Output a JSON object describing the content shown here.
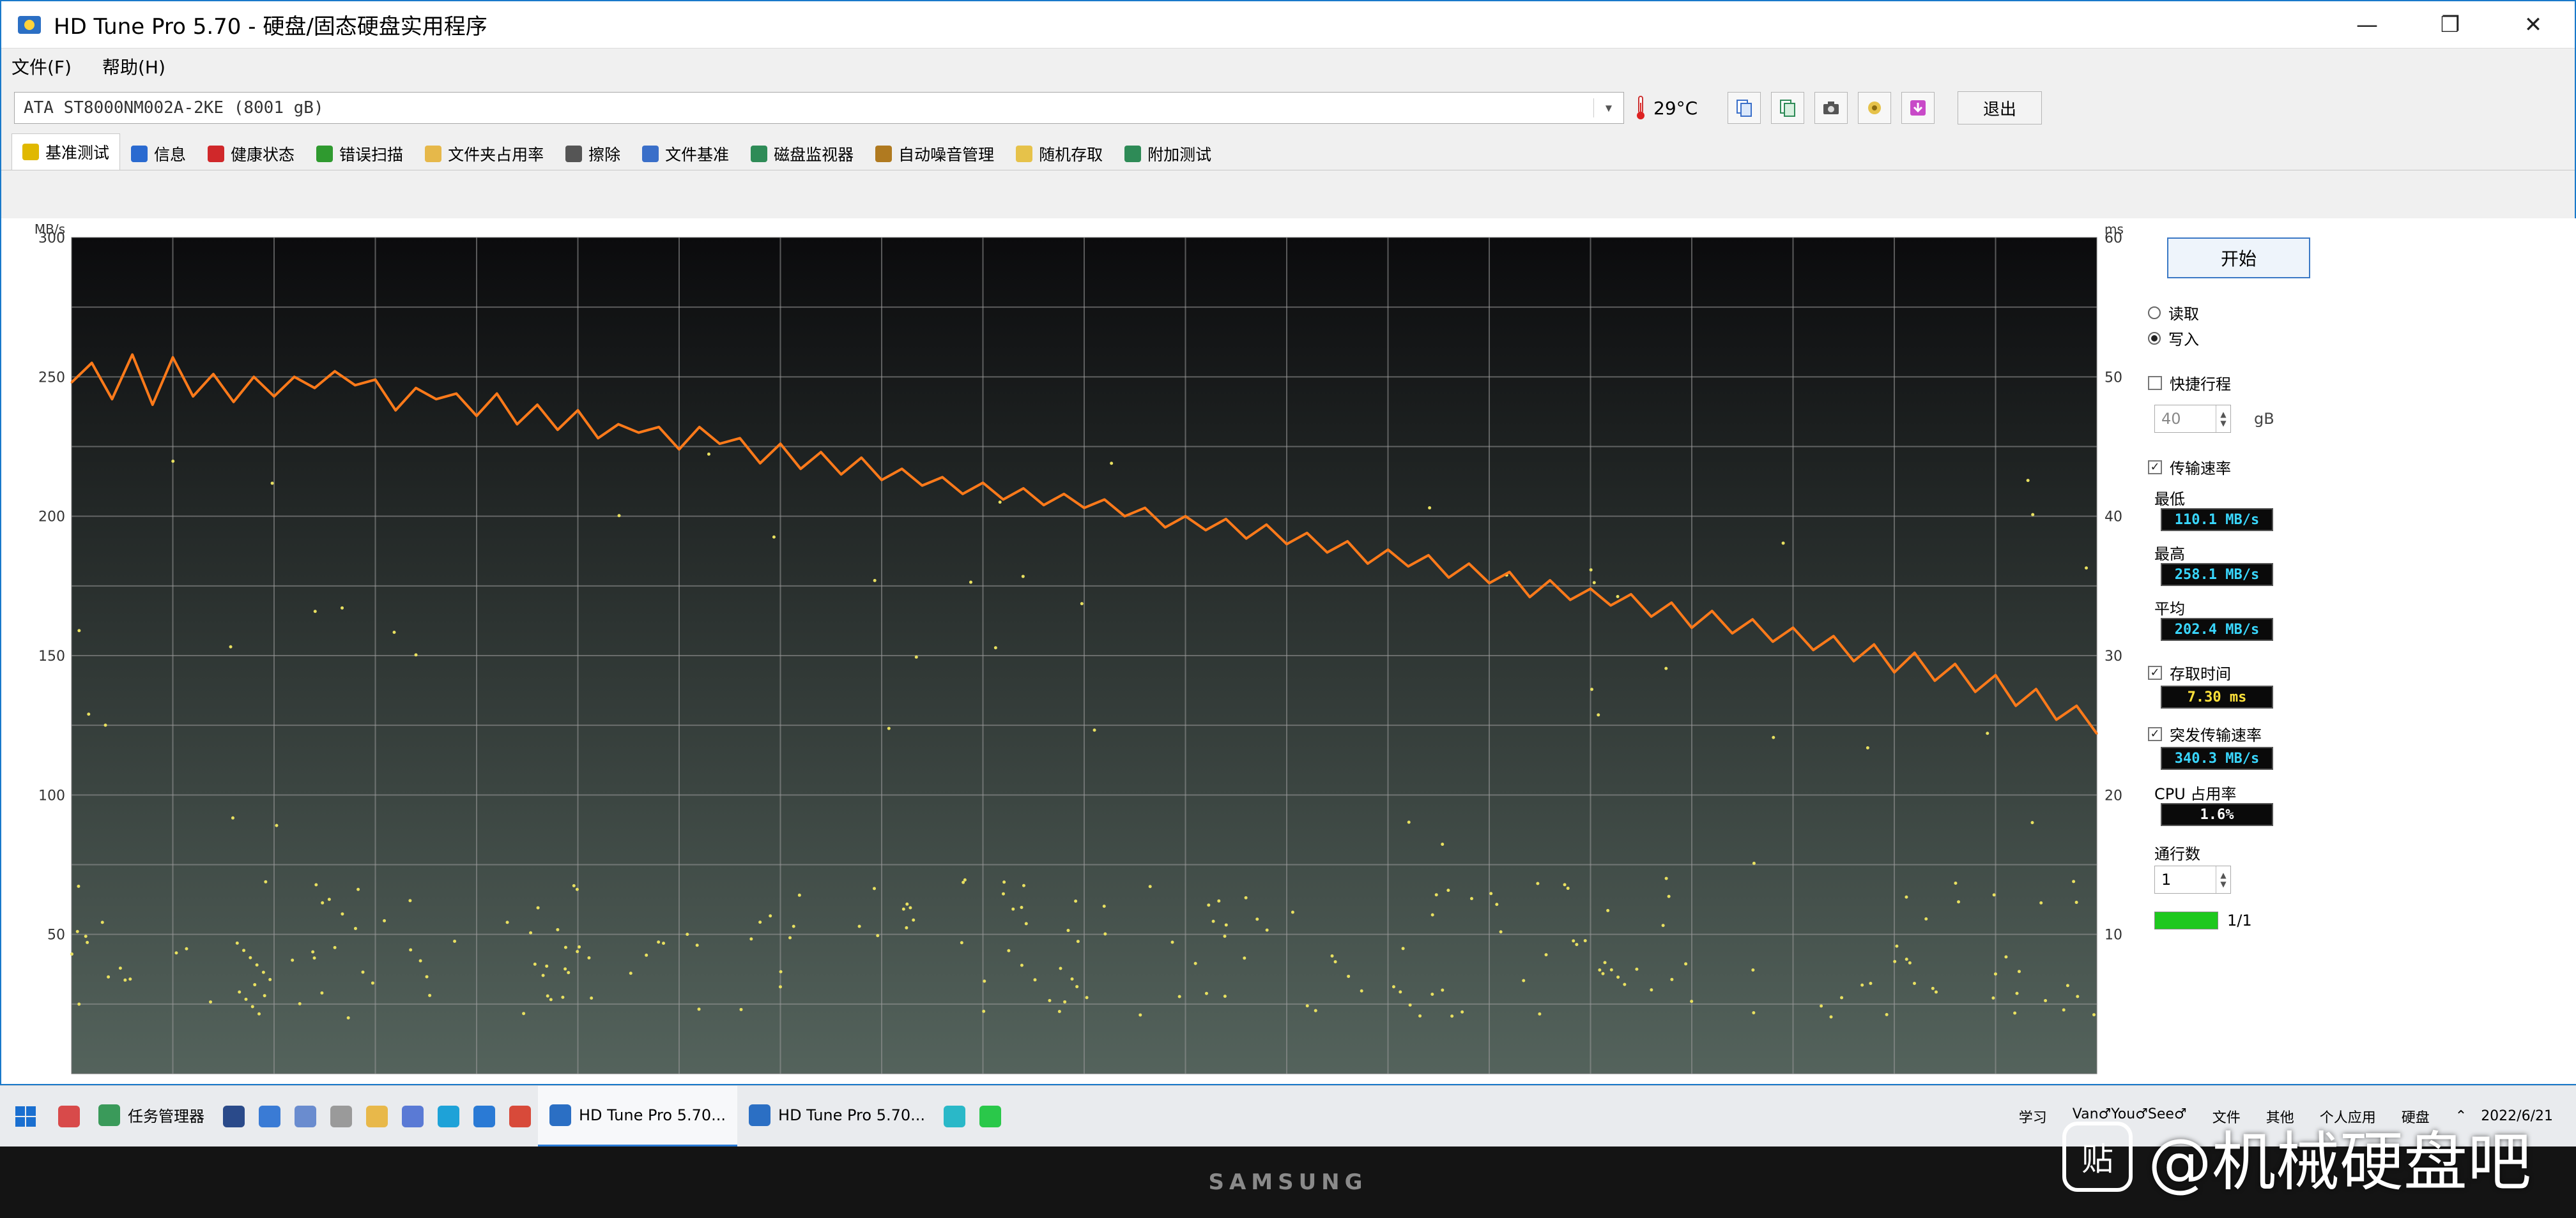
{
  "window": {
    "title": "HD Tune Pro 5.70 - 硬盘/固态硬盘实用程序",
    "minimize": "—",
    "maximize": "❐",
    "close": "✕"
  },
  "menu": [
    "文件(F)",
    "帮助(H)"
  ],
  "drive": {
    "selected": "ATA     ST8000NM002A-2KE (8001 gB)",
    "temperature": "29°C",
    "exit_label": "退出"
  },
  "tabs": [
    {
      "label": "基准测试",
      "icon": "lightbulb-icon",
      "color": "#e0b800"
    },
    {
      "label": "信息",
      "icon": "info-icon",
      "color": "#2a6ad0"
    },
    {
      "label": "健康状态",
      "icon": "health-cross-icon",
      "color": "#d0282a"
    },
    {
      "label": "错误扫描",
      "icon": "magnifier-icon",
      "color": "#2f9a2f"
    },
    {
      "label": "文件夹占用率",
      "icon": "folder-icon",
      "color": "#e6b84a"
    },
    {
      "label": "擦除",
      "icon": "eraser-icon",
      "color": "#555555"
    },
    {
      "label": "文件基准",
      "icon": "file-benchmark-icon",
      "color": "#3a6fc9"
    },
    {
      "label": "磁盘监视器",
      "icon": "monitor-icon",
      "color": "#2e8b57"
    },
    {
      "label": "自动噪音管理",
      "icon": "speaker-icon",
      "color": "#b07a20"
    },
    {
      "label": "随机存取",
      "icon": "random-access-icon",
      "color": "#e6c24a"
    },
    {
      "label": "附加测试",
      "icon": "extra-tests-icon",
      "color": "#2e8b57"
    }
  ],
  "active_tab": 0,
  "panel": {
    "start_label": "开始",
    "read_label": "读取",
    "write_label": "写入",
    "mode": "write",
    "short_stroke_label": "快捷行程",
    "short_stroke_checked": false,
    "short_stroke_value": "40",
    "short_stroke_unit": "gB",
    "transfer_rate_label": "传输速率",
    "transfer_rate_checked": true,
    "min_label": "最低",
    "min_value": "110.1 MB/s",
    "max_label": "最高",
    "max_value": "258.1 MB/s",
    "avg_label": "平均",
    "avg_value": "202.4 MB/s",
    "access_time_label": "存取时间",
    "access_time_checked": true,
    "access_time_value": "7.30 ms",
    "burst_label": "突发传输速率",
    "burst_checked": true,
    "burst_value": "340.3 MB/s",
    "cpu_label": "CPU 占用率",
    "cpu_value": "1.6%",
    "passes_label": "通行数",
    "passes_value": "1",
    "progress": 1.0,
    "progress_text": "1/1"
  },
  "chart_data": {
    "type": "line",
    "ylabel": "MB/s",
    "y2label": "ms",
    "ylim": [
      0,
      300
    ],
    "y2lim": [
      0,
      60
    ],
    "yticks": [
      50,
      100,
      150,
      200,
      250,
      300
    ],
    "y2ticks": [
      10,
      20,
      30,
      40,
      50,
      60
    ],
    "grid": true,
    "x_percent": [
      0,
      1,
      2,
      3,
      4,
      5,
      6,
      7,
      8,
      9,
      10,
      11,
      12,
      13,
      14,
      15,
      16,
      17,
      18,
      19,
      20,
      21,
      22,
      23,
      24,
      25,
      26,
      27,
      28,
      29,
      30,
      31,
      32,
      33,
      34,
      35,
      36,
      37,
      38,
      39,
      40,
      41,
      42,
      43,
      44,
      45,
      46,
      47,
      48,
      49,
      50,
      51,
      52,
      53,
      54,
      55,
      56,
      57,
      58,
      59,
      60,
      61,
      62,
      63,
      64,
      65,
      66,
      67,
      68,
      69,
      70,
      71,
      72,
      73,
      74,
      75,
      76,
      77,
      78,
      79,
      80,
      81,
      82,
      83,
      84,
      85,
      86,
      87,
      88,
      89,
      90,
      91,
      92,
      93,
      94,
      95,
      96,
      97,
      98,
      99,
      100
    ],
    "series": [
      {
        "color": "#ff7a1a",
        "values": [
          248,
          255,
          242,
          258,
          240,
          257,
          243,
          251,
          241,
          250,
          243,
          250,
          246,
          252,
          247,
          249,
          238,
          246,
          242,
          244,
          236,
          244,
          233,
          240,
          231,
          238,
          228,
          233,
          230,
          232,
          224,
          232,
          226,
          228,
          219,
          226,
          217,
          223,
          215,
          221,
          213,
          217,
          211,
          214,
          208,
          212,
          206,
          210,
          204,
          208,
          203,
          206,
          200,
          203,
          196,
          200,
          195,
          199,
          192,
          197,
          190,
          194,
          187,
          191,
          183,
          188,
          182,
          186,
          178,
          183,
          176,
          180,
          171,
          177,
          170,
          174,
          168,
          172,
          164,
          169,
          160,
          166,
          158,
          163,
          155,
          160,
          152,
          157,
          148,
          154,
          144,
          151,
          141,
          147,
          137,
          143,
          132,
          138,
          127,
          132,
          122
        ]
      }
    ],
    "access_points_note": "Access time scatter (yellow dots, ms on right axis) concentrated near 5–20 ms",
    "access_time_color": "#e8e060"
  },
  "taskbar": {
    "apps": [
      {
        "label": "任务管理器",
        "icon": "task-manager-icon",
        "active": false
      },
      {
        "label": "HD Tune Pro 5.70...",
        "icon": "hdtune-icon",
        "active": true
      },
      {
        "label": "HD Tune Pro 5.70...",
        "icon": "hdtune-icon",
        "active": false
      }
    ],
    "pinned": [
      {
        "icon": "snip-icon",
        "color": "#2a4a8a"
      },
      {
        "icon": "store-icon",
        "color": "#3a7bd5"
      },
      {
        "icon": "paint-icon",
        "color": "#6a8ccf"
      },
      {
        "icon": "clock-icon",
        "color": "#9a9a9a"
      },
      {
        "icon": "explorer-icon",
        "color": "#e8b84a"
      },
      {
        "icon": "calendar-icon",
        "color": "#5a7ad5"
      },
      {
        "icon": "edge-icon",
        "color": "#1ea2d8"
      },
      {
        "icon": "star-app-icon",
        "color": "#2a7ad5"
      },
      {
        "icon": "chrome-icon",
        "color": "#d84a3a"
      },
      {
        "icon": "globe-icon",
        "color": "#2ab8c8"
      },
      {
        "icon": "plus-app-icon",
        "color": "#2ac84a"
      }
    ],
    "toolbars": [
      "学习",
      "Van♂You♂See♂",
      "文件",
      "其他",
      "个人应用",
      "硬盘"
    ],
    "tray_time": "2022/6/21"
  },
  "bezel_brand": "SAMSUNG",
  "watermark": "@机械硬盘吧",
  "watermark_logo": "贴"
}
